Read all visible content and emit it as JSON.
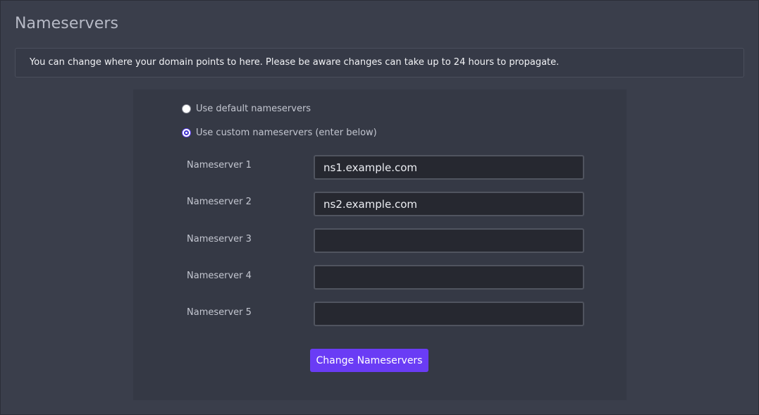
{
  "page": {
    "title": "Nameservers",
    "info_text": "You can change where your domain points to here. Please be aware changes can take up to 24 hours to propagate."
  },
  "options": {
    "default_label": "Use default nameservers",
    "custom_label": "Use custom nameservers (enter below)",
    "selected": "custom"
  },
  "nameservers": [
    {
      "label": "Nameserver 1",
      "value": "ns1.example.com"
    },
    {
      "label": "Nameserver 2",
      "value": "ns2.example.com"
    },
    {
      "label": "Nameserver 3",
      "value": ""
    },
    {
      "label": "Nameserver 4",
      "value": ""
    },
    {
      "label": "Nameserver 5",
      "value": ""
    }
  ],
  "actions": {
    "submit_label": "Change Nameservers"
  },
  "colors": {
    "background": "#3a3e4b",
    "panel": "#353945",
    "accent": "#6a3cf5",
    "input_bg": "#262830"
  }
}
